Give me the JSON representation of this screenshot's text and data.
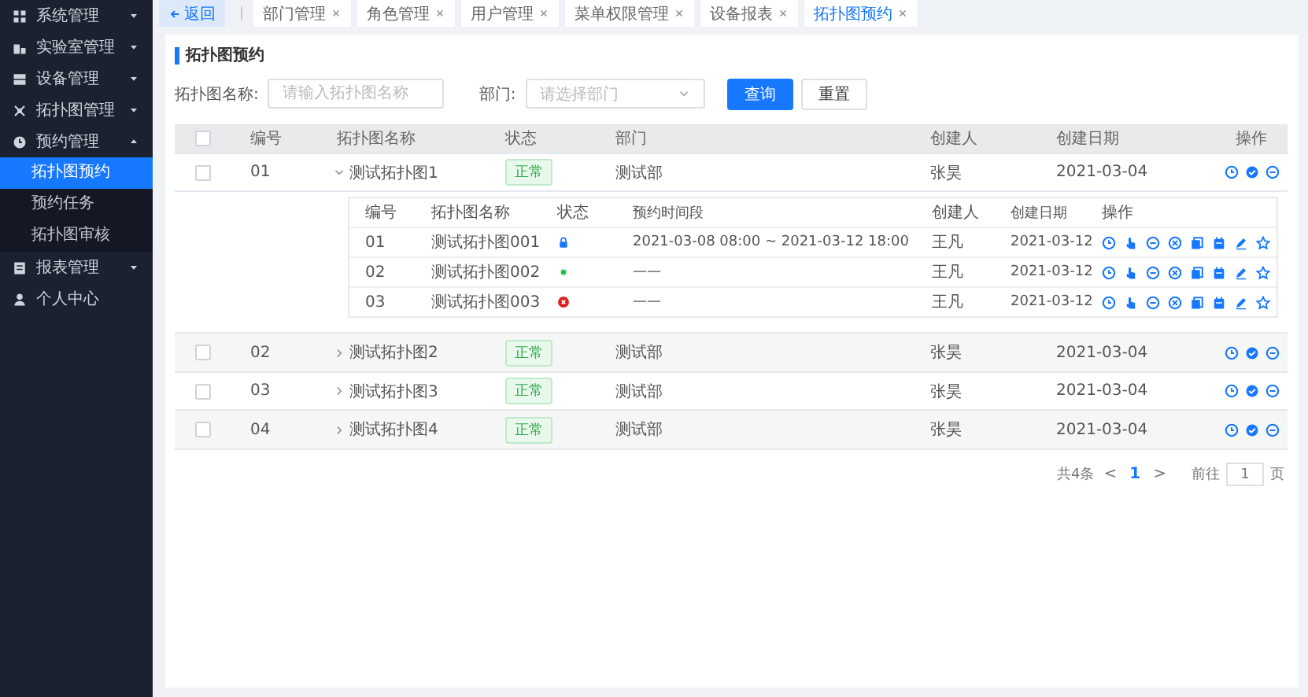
{
  "sidebar": {
    "items": [
      {
        "label": "系统管理",
        "kind": "group",
        "expanded": false
      },
      {
        "label": "实验室管理",
        "kind": "group",
        "expanded": false
      },
      {
        "label": "设备管理",
        "kind": "group",
        "expanded": false
      },
      {
        "label": "拓扑图管理",
        "kind": "group",
        "expanded": false
      },
      {
        "label": "预约管理",
        "kind": "group",
        "expanded": true,
        "children": [
          {
            "label": "拓扑图预约",
            "selected": true
          },
          {
            "label": "预约任务",
            "selected": false
          },
          {
            "label": "拓扑图审核",
            "selected": false
          }
        ]
      },
      {
        "label": "报表管理",
        "kind": "group",
        "expanded": false
      },
      {
        "label": "个人中心",
        "kind": "link"
      }
    ]
  },
  "back_button": "返回",
  "tabs": [
    {
      "label": "部门管理",
      "selected": false
    },
    {
      "label": "角色管理",
      "selected": false
    },
    {
      "label": "用户管理",
      "selected": false
    },
    {
      "label": "菜单权限管理",
      "selected": false
    },
    {
      "label": "设备报表",
      "selected": false
    },
    {
      "label": "拓扑图预约",
      "selected": true
    }
  ],
  "page_title": "拓扑图预约",
  "filters": [
    {
      "label": "拓扑图名称:",
      "kind": "text",
      "placeholder": "请输入拓扑图名称"
    },
    {
      "label": "部门:",
      "kind": "select",
      "placeholder": "请选择部门"
    }
  ],
  "buttons": [
    {
      "label": "查询",
      "kind": "primary"
    },
    {
      "label": "重置",
      "kind": "default"
    }
  ],
  "table": {
    "header_checked": false,
    "columns": [
      "编号",
      "拓扑图名称",
      "状态",
      "部门",
      "创建人",
      "创建日期",
      "操作"
    ],
    "rows": [
      {
        "checked": false,
        "expanded": true,
        "id": "01",
        "name": "测试拓扑图1",
        "status": "正常",
        "dept": "测试部",
        "creator": "张昊",
        "date": "2021-03-04",
        "sub_table": {
          "columns": [
            "编号",
            "拓扑图名称",
            "状态",
            "预约时间段",
            "创建人",
            "创建日期",
            "操作"
          ],
          "rows": [
            {
              "id": "01",
              "name": "测试拓扑图001",
              "kind": "locked",
              "period": "2021-03-08  08:00  ~  2021-03-12  18:00",
              "creator": "王凡",
              "date": "2021-03-12"
            },
            {
              "id": "02",
              "name": "测试拓扑图002",
              "kind": "active",
              "period": "——",
              "creator": "王凡",
              "date": "2021-03-12"
            },
            {
              "id": "03",
              "name": "测试拓扑图003",
              "kind": "error",
              "period": "——",
              "creator": "王凡",
              "date": "2021-03-12"
            }
          ]
        }
      },
      {
        "checked": false,
        "expanded": false,
        "id": "02",
        "name": "测试拓扑图2",
        "status": "正常",
        "dept": "测试部",
        "creator": "张昊",
        "date": "2021-03-04"
      },
      {
        "checked": false,
        "expanded": false,
        "id": "03",
        "name": "测试拓扑图3",
        "status": "正常",
        "dept": "测试部",
        "creator": "张昊",
        "date": "2021-03-04"
      },
      {
        "checked": false,
        "expanded": false,
        "id": "04",
        "name": "测试拓扑图4",
        "status": "正常",
        "dept": "测试部",
        "creator": "张昊",
        "date": "2021-03-04"
      }
    ]
  },
  "pagination": {
    "total": "共4条",
    "prev": "<",
    "pages": [
      {
        "label": "1",
        "selected": true
      }
    ],
    "next": ">",
    "goto_label": "前往",
    "goto_value": "1",
    "goto_suffix": "页"
  }
}
